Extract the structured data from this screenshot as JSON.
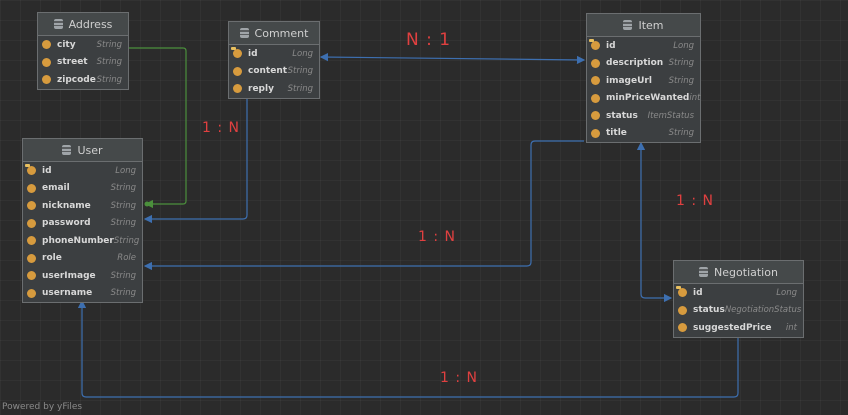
{
  "entities": {
    "address": {
      "title": "Address",
      "fields": [
        {
          "name": "city",
          "type": "String"
        },
        {
          "name": "street",
          "type": "String"
        },
        {
          "name": "zipcode",
          "type": "String"
        }
      ]
    },
    "comment": {
      "title": "Comment",
      "fields": [
        {
          "name": "id",
          "type": "Long"
        },
        {
          "name": "content",
          "type": "String"
        },
        {
          "name": "reply",
          "type": "String"
        }
      ]
    },
    "item": {
      "title": "Item",
      "fields": [
        {
          "name": "id",
          "type": "Long"
        },
        {
          "name": "description",
          "type": "String"
        },
        {
          "name": "imageUrl",
          "type": "String"
        },
        {
          "name": "minPriceWanted",
          "type": "int"
        },
        {
          "name": "status",
          "type": "ItemStatus"
        },
        {
          "name": "title",
          "type": "String"
        }
      ]
    },
    "user": {
      "title": "User",
      "fields": [
        {
          "name": "id",
          "type": "Long"
        },
        {
          "name": "email",
          "type": "String"
        },
        {
          "name": "nickname",
          "type": "String"
        },
        {
          "name": "password",
          "type": "String"
        },
        {
          "name": "phoneNumber",
          "type": "String"
        },
        {
          "name": "role",
          "type": "Role"
        },
        {
          "name": "userImage",
          "type": "String"
        },
        {
          "name": "username",
          "type": "String"
        }
      ]
    },
    "negotiation": {
      "title": "Negotiation",
      "fields": [
        {
          "name": "id",
          "type": "Long"
        },
        {
          "name": "status",
          "type": "NegotiationStatus"
        },
        {
          "name": "suggestedPrice",
          "type": "int"
        }
      ]
    }
  },
  "relations": {
    "comment_item": "N : 1",
    "comment_user": "1 : N",
    "item_user": "1 : N",
    "item_negotiation": "1 : N",
    "negotiation_user": "1 : N"
  },
  "colors": {
    "edge": "#3d6fb0",
    "address_edge": "#4b8f3c",
    "cardinality": "#e04040"
  },
  "footer": "Powered by yFiles"
}
